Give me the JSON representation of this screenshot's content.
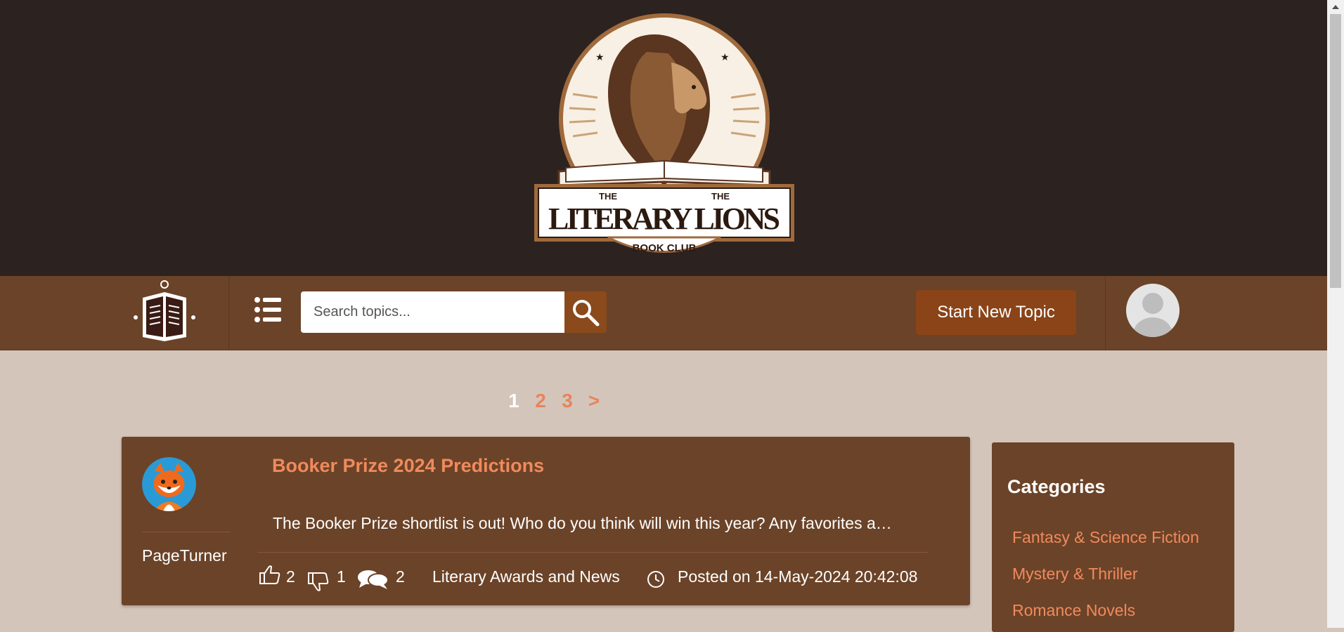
{
  "header": {
    "logo": {
      "top_text_left": "THE",
      "top_text_right": "THE",
      "title": "LITERARY LIONS",
      "subtitle": "BOOK CLUB"
    }
  },
  "navbar": {
    "search": {
      "placeholder": "Search topics...",
      "value": ""
    },
    "new_topic_label": "Start New Topic"
  },
  "pagination": {
    "pages": [
      "1",
      "2",
      "3",
      ">"
    ],
    "current": "1"
  },
  "topics": [
    {
      "author": "PageTurner",
      "title": "Booker Prize 2024 Predictions",
      "excerpt": "The Booker Prize shortlist is out! Who do you think will win this year? Any favorites a…",
      "likes": "2",
      "dislikes": "1",
      "comments": "2",
      "category": "Literary Awards and News",
      "posted": "Posted on 14-May-2024 20:42:08"
    }
  ],
  "sidebar": {
    "title": "Categories",
    "categories": [
      "Fantasy & Science Fiction",
      "Mystery & Thriller",
      "Romance Novels"
    ]
  },
  "colors": {
    "header_bg": "#2c2220",
    "nav_bg": "#6b4328",
    "page_bg": "#d4c5bb",
    "accent": "#f08a5d",
    "button": "#8a4418"
  }
}
